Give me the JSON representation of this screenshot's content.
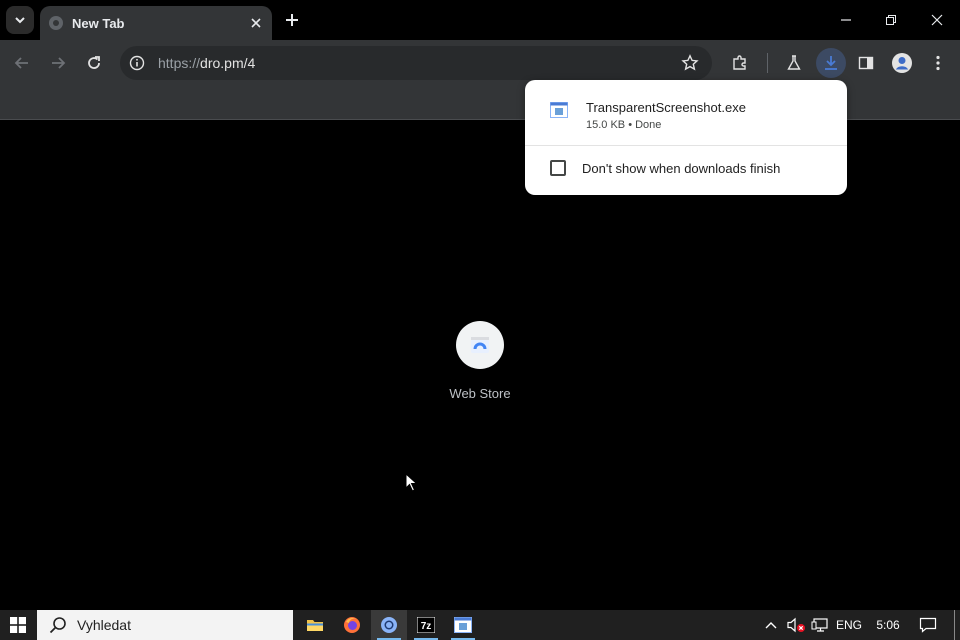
{
  "window": {
    "tab_title": "New Tab"
  },
  "toolbar": {
    "url_scheme": "https://",
    "url_host": "dro.pm/4"
  },
  "shortcuts": [
    {
      "label": "Web Store"
    }
  ],
  "download_bubble": {
    "filename": "TransparentScreenshot.exe",
    "meta": "15.0 KB • Done",
    "checkbox_label": "Don't show when downloads finish",
    "checkbox_checked": false
  },
  "taskbar": {
    "search_placeholder": "Vyhledat",
    "language": "ENG",
    "time": "5:06"
  },
  "colors": {
    "accent_download": "#4a7bd4",
    "taskbar_indicator": "#76b9ed"
  }
}
